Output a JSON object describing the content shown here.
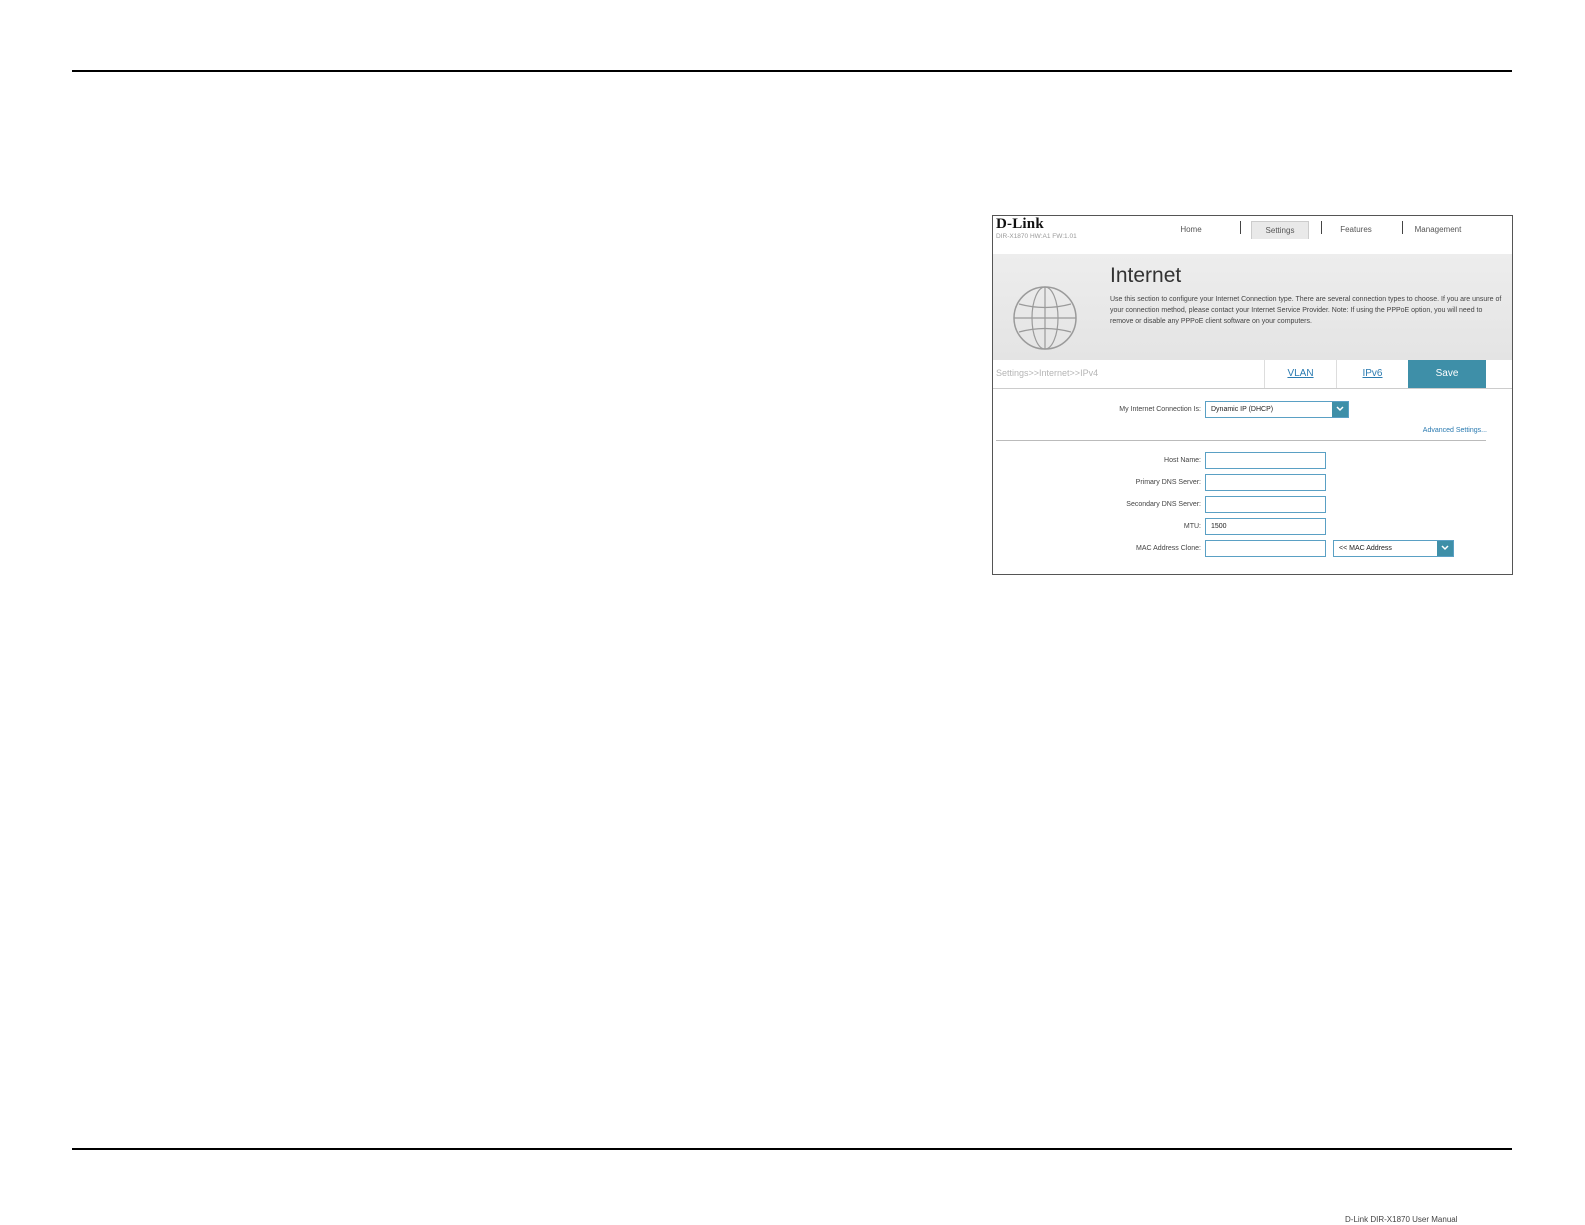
{
  "router": {
    "logo": "D-Link",
    "model": "DIR-X1870 HW:A1 FW:1.01",
    "nav": [
      "Home",
      "Settings",
      "Features",
      "Management"
    ],
    "active_nav": "Settings"
  },
  "hero": {
    "title": "Internet",
    "description": "Use this section to configure your Internet Connection type. There are several connection types to choose. If you are unsure of your connection method, please contact your Internet Service Provider. Note: If using the PPPoE option, you will need to remove or disable any PPPoE client software on your computers."
  },
  "tabs": {
    "breadcrumb": "Settings>>Internet>>IPv4",
    "vlan": "VLAN",
    "ipv6": "IPv6",
    "save": "Save"
  },
  "form": {
    "connection_label": "My Internet Connection Is:",
    "connection_value": "Dynamic IP (DHCP)",
    "advanced": "Advanced Settings...",
    "host_label": "Host Name:",
    "host_value": "",
    "dns1_label": "Primary DNS Server:",
    "dns1_value": "",
    "dns2_label": "Secondary DNS Server:",
    "dns2_value": "",
    "mtu_label": "MTU:",
    "mtu_value": "1500",
    "mac_label": "MAC Address Clone:",
    "mac_value": "",
    "mac_select": "<< MAC Address"
  },
  "colors": {
    "accent": "#3e8fa8",
    "link": "#2a7ab0"
  },
  "page_footer": "D-Link DIR-X1870 User Manual"
}
